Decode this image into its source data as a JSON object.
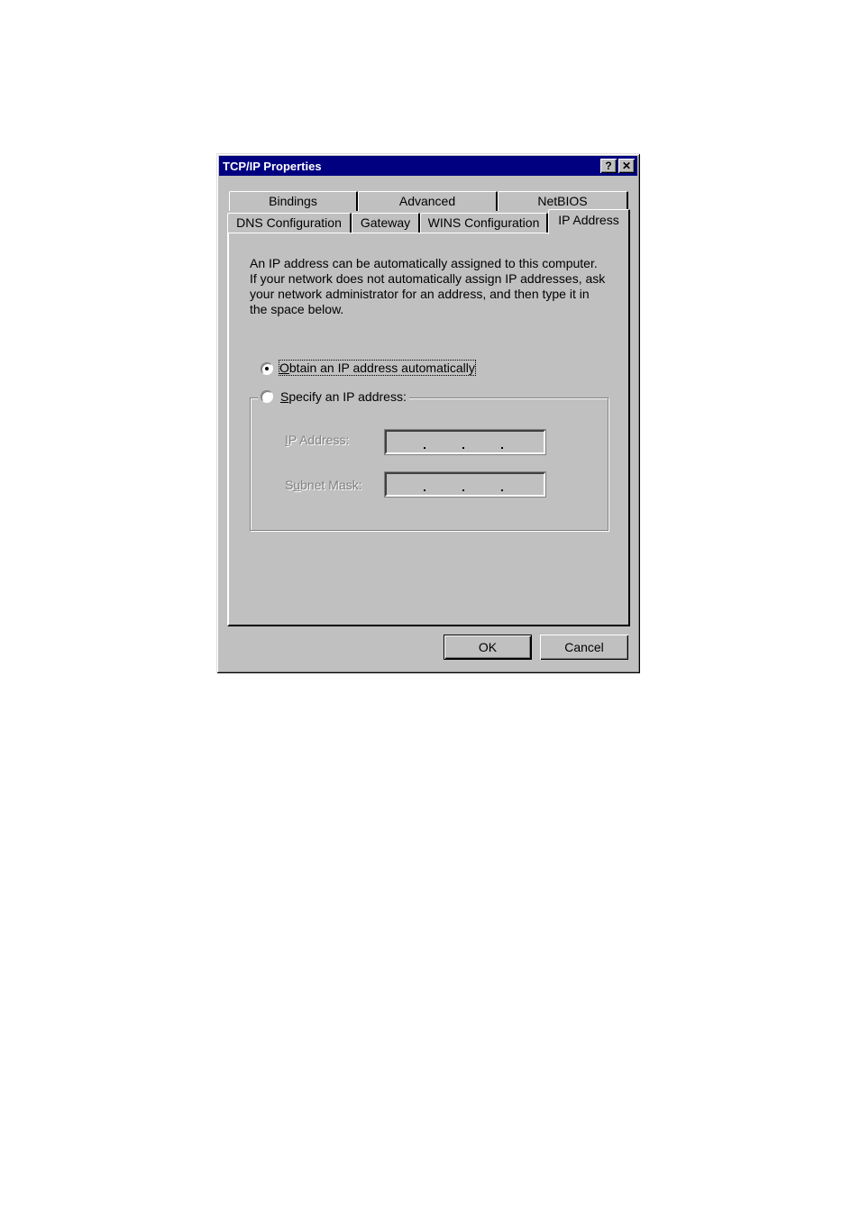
{
  "window": {
    "title": "TCP/IP Properties",
    "help_button": "?",
    "close_button": "✕"
  },
  "tabs": {
    "row_back": [
      {
        "label": "Bindings"
      },
      {
        "label": "Advanced"
      },
      {
        "label": "NetBIOS"
      }
    ],
    "row_front": [
      {
        "label": "DNS Configuration"
      },
      {
        "label": "Gateway"
      },
      {
        "label": "WINS Configuration"
      },
      {
        "label": "IP Address",
        "selected": true
      }
    ]
  },
  "panel": {
    "description_lines": [
      "An IP address can be automatically assigned to this computer.",
      "If your network does not automatically assign IP addresses, ask",
      "your network administrator for an address, and then type it in",
      "the space below."
    ],
    "options": [
      {
        "mnemonic": "O",
        "rest": "btain an IP address automatically",
        "selected": true
      },
      {
        "mnemonic": "S",
        "rest": "pecify an IP address:",
        "selected": false
      }
    ],
    "fields": [
      {
        "mnemonic": "I",
        "rest": "P Address:",
        "value": [
          "",
          "",
          "",
          ""
        ],
        "separator": "."
      },
      {
        "pre": "S",
        "mnemonic": "u",
        "rest": "bnet Mask:",
        "value": [
          "",
          "",
          "",
          ""
        ],
        "separator": "."
      }
    ]
  },
  "buttons": {
    "ok": "OK",
    "cancel": "Cancel"
  }
}
